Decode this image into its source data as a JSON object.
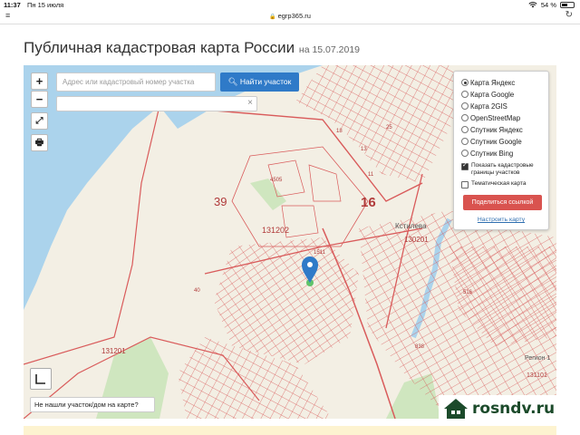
{
  "status_bar": {
    "time": "11:37",
    "date": "Пн 15 июля",
    "battery_pct": "54 %",
    "battery_level": 0.54
  },
  "browser": {
    "url": "egrp365.ru"
  },
  "page": {
    "title": "Публичная кадастровая карта России",
    "date_suffix": "на 15.07.2019"
  },
  "map_controls": {
    "zoom_in": "+",
    "zoom_out": "−",
    "search_placeholder": "Адрес или кадастровый номер участка",
    "find_button": "Найти участок",
    "clear_symbol": "×"
  },
  "layers": {
    "options": [
      {
        "label": "Карта Яндекс",
        "selected": true
      },
      {
        "label": "Карта Google",
        "selected": false
      },
      {
        "label": "Карта 2GIS",
        "selected": false
      },
      {
        "label": "OpenStreetMap",
        "selected": false
      },
      {
        "label": "Спутник Яндекс",
        "selected": false
      },
      {
        "label": "Спутник Google",
        "selected": false
      },
      {
        "label": "Спутник Bing",
        "selected": false
      }
    ],
    "checkbox_cadastral": {
      "label": "Показать кадастровые границы участков",
      "checked": true
    },
    "checkbox_thematic": {
      "label": "Тематическая карта",
      "checked": false
    },
    "share_button": "Поделиться ссылкой",
    "settings_link": "Настроить карту"
  },
  "map_labels": {
    "block_39": "39",
    "block_16": "16",
    "quarter_131202": "131202",
    "quarter_130201": "130201",
    "quarter_131201": "131201",
    "settlement": "Кстилева",
    "region_label": "Регион 1",
    "num_40": "40",
    "num_4505": "4505",
    "num_11": "11",
    "num_13": "13",
    "num_18": "18",
    "num_25": "25",
    "num_838": "838",
    "num_516": "516",
    "num_1511": "1511",
    "num_131101": "131101"
  },
  "not_found_text": "Не нашли участок/дом на карте?",
  "watermark": {
    "text": "rosndv.ru"
  },
  "colors": {
    "water": "#abd3ec",
    "land": "#f3efe4",
    "parcel_line": "#d95b5b",
    "accent_blue": "#2f7ac8",
    "share_red": "#d9534f",
    "pin": "#2f7ac8"
  }
}
